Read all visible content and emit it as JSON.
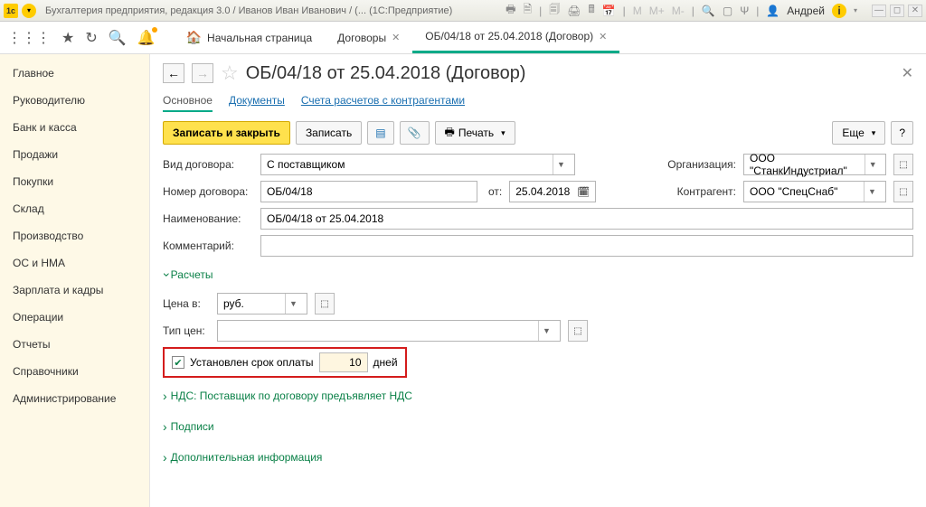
{
  "titlebar": {
    "title": "Бухгалтерия предприятия, редакция 3.0 / Иванов Иван Иванович / (...  (1С:Предприятие)",
    "user": "Андрей",
    "m_labels": [
      "M",
      "M+",
      "M-"
    ]
  },
  "tabs": {
    "home": "Начальная страница",
    "t1": "Договоры",
    "t2": "ОБ/04/18 от 25.04.2018 (Договор)"
  },
  "sidebar": {
    "items": [
      "Главное",
      "Руководителю",
      "Банк и касса",
      "Продажи",
      "Покупки",
      "Склад",
      "Производство",
      "ОС и НМА",
      "Зарплата и кадры",
      "Операции",
      "Отчеты",
      "Справочники",
      "Администрирование"
    ]
  },
  "content": {
    "title": "ОБ/04/18 от 25.04.2018 (Договор)",
    "subtabs": {
      "main": "Основное",
      "docs": "Документы",
      "accounts": "Счета расчетов с контрагентами"
    },
    "actions": {
      "save_close": "Записать и закрыть",
      "save": "Записать",
      "print": "Печать",
      "more": "Еще",
      "help": "?"
    },
    "form": {
      "type_label": "Вид договора:",
      "type_value": "С поставщиком",
      "org_label": "Организация:",
      "org_value": "ООО \"СтанкИндустриал\"",
      "number_label": "Номер договора:",
      "number_value": "ОБ/04/18",
      "date_label": "от:",
      "date_value": "25.04.2018",
      "counterparty_label": "Контрагент:",
      "counterparty_value": "ООО \"СпецСнаб\"",
      "name_label": "Наименование:",
      "name_value": "ОБ/04/18 от 25.04.2018",
      "comment_label": "Комментарий:",
      "comment_value": ""
    },
    "calc": {
      "section": "Расчеты",
      "price_in_label": "Цена в:",
      "price_in_value": "руб.",
      "price_type_label": "Тип цен:",
      "price_type_value": "",
      "terms_checkbox": "Установлен срок оплаты",
      "terms_days": "10",
      "terms_days_label": "дней"
    },
    "folds": {
      "vat": "НДС: Поставщик по договору предъявляет НДС",
      "sign": "Подписи",
      "extra": "Дополнительная информация"
    }
  }
}
